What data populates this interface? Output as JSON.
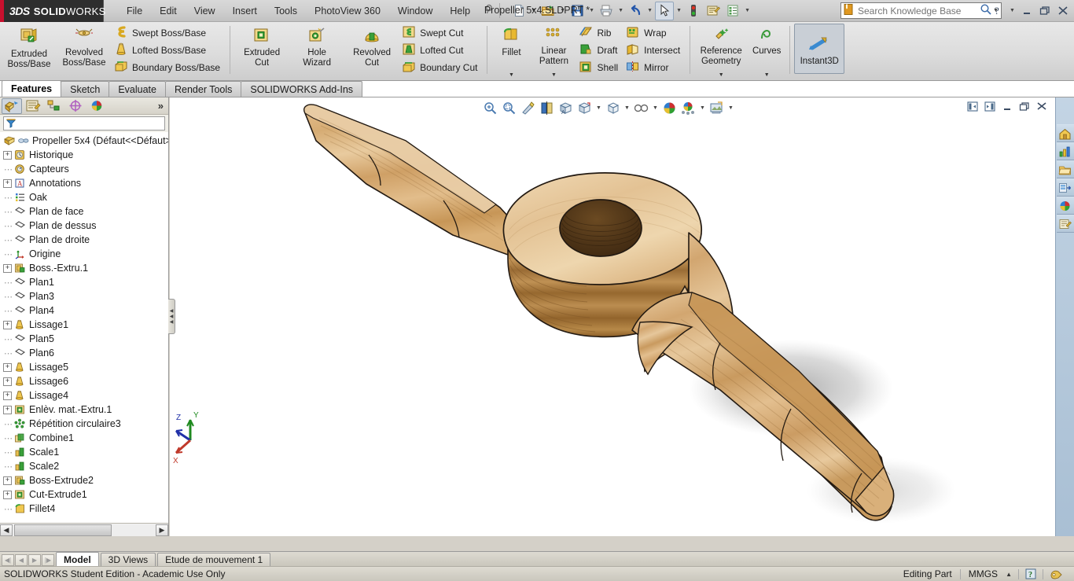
{
  "app": {
    "brand_3ds": "3DS",
    "brand_name_bold": "SOLID",
    "brand_name_light": "WORKS",
    "document_title": "Propeller 5x4.SLDPRT *",
    "accent_red": "#c8102e",
    "logo_bg": "#2e2e2e"
  },
  "menubar": {
    "items": [
      {
        "label": "File",
        "name": "menu-file"
      },
      {
        "label": "Edit",
        "name": "menu-edit"
      },
      {
        "label": "View",
        "name": "menu-view"
      },
      {
        "label": "Insert",
        "name": "menu-insert"
      },
      {
        "label": "Tools",
        "name": "menu-tools"
      },
      {
        "label": "PhotoView 360",
        "name": "menu-photoview-360"
      },
      {
        "label": "Window",
        "name": "menu-window"
      },
      {
        "label": "Help",
        "name": "menu-help"
      }
    ],
    "pin_icon": "pushpin-icon"
  },
  "quick_access": {
    "buttons": [
      {
        "name": "new-document-icon",
        "has_caret": true
      },
      {
        "name": "open-folder-icon",
        "has_caret": true
      },
      {
        "name": "save-icon",
        "has_caret": true
      },
      {
        "name": "print-icon",
        "has_caret": true
      },
      {
        "name": "undo-icon",
        "has_caret": true
      },
      {
        "name": "select-arrow-icon",
        "has_caret": true,
        "pressed": true
      },
      {
        "name": "rebuild-traffic-light-icon",
        "has_caret": false
      },
      {
        "name": "options-icon",
        "has_caret": false
      },
      {
        "name": "customize-menu-icon",
        "has_caret": true
      }
    ]
  },
  "search": {
    "placeholder": "Search Knowledge Base",
    "value": "",
    "icon": "knowledge-base-book-icon",
    "magnifier": "magnifier-icon",
    "caret": "chevron-down-icon"
  },
  "window_controls": {
    "help": "help-question-icon",
    "help_caret": "chevron-down-icon",
    "minimize": "minimize-icon",
    "restore": "restore-icon",
    "close": "close-icon"
  },
  "ribbon": {
    "groups": [
      {
        "name": "boss-base-group",
        "big": [
          {
            "label": "Extruded\nBoss/Base",
            "label_l1": "Extruded",
            "label_l2": "Boss/Base",
            "name": "extruded-boss-base-button",
            "icon": "extruded-boss-icon"
          },
          {
            "label_l1": "Revolved",
            "label_l2": "Boss/Base",
            "name": "revolved-boss-base-button",
            "icon": "revolved-boss-icon"
          }
        ],
        "small": [
          {
            "label": "Swept Boss/Base",
            "name": "swept-boss-base-button",
            "icon": "swept-boss-icon"
          },
          {
            "label": "Lofted Boss/Base",
            "name": "lofted-boss-base-button",
            "icon": "lofted-boss-icon"
          },
          {
            "label": "Boundary Boss/Base",
            "name": "boundary-boss-base-button",
            "icon": "boundary-boss-icon"
          }
        ]
      },
      {
        "name": "cut-group",
        "big": [
          {
            "label_l1": "Extruded",
            "label_l2": "Cut",
            "name": "extruded-cut-button",
            "icon": "extruded-cut-icon"
          },
          {
            "label_l1": "Hole",
            "label_l2": "Wizard",
            "name": "hole-wizard-button",
            "icon": "hole-wizard-icon"
          },
          {
            "label_l1": "Revolved",
            "label_l2": "Cut",
            "name": "revolved-cut-button",
            "icon": "revolved-cut-icon"
          }
        ],
        "small": [
          {
            "label": "Swept Cut",
            "name": "swept-cut-button",
            "icon": "swept-cut-icon"
          },
          {
            "label": "Lofted Cut",
            "name": "lofted-cut-button",
            "icon": "lofted-cut-icon"
          },
          {
            "label": "Boundary Cut",
            "name": "boundary-cut-button",
            "icon": "boundary-cut-icon"
          }
        ]
      },
      {
        "name": "features-group",
        "big": [
          {
            "label_l1": "Fillet",
            "label_l2": "",
            "name": "fillet-button",
            "icon": "fillet-icon",
            "dropdown": true
          },
          {
            "label_l1": "Linear",
            "label_l2": "Pattern",
            "name": "linear-pattern-button",
            "icon": "linear-pattern-icon",
            "dropdown": true
          }
        ],
        "small": [
          {
            "label": "Rib",
            "name": "rib-button",
            "icon": "rib-icon"
          },
          {
            "label": "Draft",
            "name": "draft-button",
            "icon": "draft-icon"
          },
          {
            "label": "Shell",
            "name": "shell-button",
            "icon": "shell-icon"
          }
        ],
        "small2": [
          {
            "label": "Wrap",
            "name": "wrap-button",
            "icon": "wrap-icon"
          },
          {
            "label": "Intersect",
            "name": "intersect-button",
            "icon": "intersect-icon"
          },
          {
            "label": "Mirror",
            "name": "mirror-button",
            "icon": "mirror-icon"
          }
        ]
      },
      {
        "name": "reference-group",
        "big": [
          {
            "label_l1": "Reference",
            "label_l2": "Geometry",
            "name": "reference-geometry-button",
            "icon": "reference-geometry-icon",
            "dropdown": true
          },
          {
            "label_l1": "Curves",
            "label_l2": "",
            "name": "curves-button",
            "icon": "curves-icon",
            "dropdown": true
          }
        ]
      },
      {
        "name": "instant3d-group",
        "big": [
          {
            "label_l1": "Instant3D",
            "label_l2": "",
            "name": "instant3d-button",
            "icon": "instant3d-icon",
            "selected": true
          }
        ]
      }
    ]
  },
  "ribbon_tabs": {
    "items": [
      {
        "label": "Features",
        "name": "tab-features",
        "active": true
      },
      {
        "label": "Sketch",
        "name": "tab-sketch",
        "active": false
      },
      {
        "label": "Evaluate",
        "name": "tab-evaluate",
        "active": false
      },
      {
        "label": "Render Tools",
        "name": "tab-render-tools",
        "active": false
      },
      {
        "label": "SOLIDWORKS Add-Ins",
        "name": "tab-solidworks-add-ins",
        "active": false
      }
    ]
  },
  "tree_panel": {
    "tabs": [
      {
        "name": "feature-manager-tree-tab",
        "icon": "feature-tree-icon",
        "active": true
      },
      {
        "name": "property-manager-tab",
        "icon": "property-manager-icon",
        "active": false
      },
      {
        "name": "configuration-manager-tab",
        "icon": "configuration-manager-icon",
        "active": false
      },
      {
        "name": "dimxpert-manager-tab",
        "icon": "dimxpert-icon",
        "active": false
      },
      {
        "name": "display-manager-tab",
        "icon": "display-manager-icon",
        "active": false
      }
    ],
    "more_icon": "double-chevron-right-icon",
    "filter": {
      "placeholder": "",
      "value": "",
      "icon": "filter-funnel-icon"
    },
    "items": [
      {
        "label": "Propeller 5x4  (Défaut<<Défaut>",
        "icon": "part-icon",
        "indent": 0,
        "expander": "none",
        "root": true
      },
      {
        "label": "Historique",
        "icon": "history-icon",
        "indent": 1,
        "expander": "plus"
      },
      {
        "label": "Capteurs",
        "icon": "sensors-icon",
        "indent": 1,
        "expander": "none"
      },
      {
        "label": "Annotations",
        "icon": "annotations-icon",
        "indent": 1,
        "expander": "plus"
      },
      {
        "label": "Oak",
        "icon": "material-icon",
        "indent": 1,
        "expander": "none"
      },
      {
        "label": "Plan de face",
        "icon": "plane-icon",
        "indent": 1,
        "expander": "none"
      },
      {
        "label": "Plan de dessus",
        "icon": "plane-icon",
        "indent": 1,
        "expander": "none"
      },
      {
        "label": "Plan de droite",
        "icon": "plane-icon",
        "indent": 1,
        "expander": "none"
      },
      {
        "label": "Origine",
        "icon": "origin-icon",
        "indent": 1,
        "expander": "none"
      },
      {
        "label": "Boss.-Extru.1",
        "icon": "boss-extrude-icon",
        "indent": 1,
        "expander": "plus"
      },
      {
        "label": "Plan1",
        "icon": "plane-icon",
        "indent": 1,
        "expander": "none"
      },
      {
        "label": "Plan3",
        "icon": "plane-icon",
        "indent": 1,
        "expander": "none"
      },
      {
        "label": "Plan4",
        "icon": "plane-icon",
        "indent": 1,
        "expander": "none"
      },
      {
        "label": "Lissage1",
        "icon": "loft-icon",
        "indent": 1,
        "expander": "plus"
      },
      {
        "label": "Plan5",
        "icon": "plane-icon",
        "indent": 1,
        "expander": "none"
      },
      {
        "label": "Plan6",
        "icon": "plane-icon",
        "indent": 1,
        "expander": "none"
      },
      {
        "label": "Lissage5",
        "icon": "loft-icon",
        "indent": 1,
        "expander": "plus"
      },
      {
        "label": "Lissage6",
        "icon": "loft-icon",
        "indent": 1,
        "expander": "plus"
      },
      {
        "label": "Lissage4",
        "icon": "loft-icon",
        "indent": 1,
        "expander": "plus"
      },
      {
        "label": "Enlèv. mat.-Extru.1",
        "icon": "cut-extrude-icon",
        "indent": 1,
        "expander": "plus"
      },
      {
        "label": "Répétition circulaire3",
        "icon": "circular-pattern-icon",
        "indent": 1,
        "expander": "none"
      },
      {
        "label": "Combine1",
        "icon": "combine-icon",
        "indent": 1,
        "expander": "none"
      },
      {
        "label": "Scale1",
        "icon": "scale-icon",
        "indent": 1,
        "expander": "none"
      },
      {
        "label": "Scale2",
        "icon": "scale-icon",
        "indent": 1,
        "expander": "none"
      },
      {
        "label": "Boss-Extrude2",
        "icon": "boss-extrude-icon",
        "indent": 1,
        "expander": "plus"
      },
      {
        "label": "Cut-Extrude1",
        "icon": "cut-extrude-icon",
        "indent": 1,
        "expander": "plus"
      },
      {
        "label": "Fillet4",
        "icon": "fillet-tree-icon",
        "indent": 1,
        "expander": "none"
      }
    ],
    "hscroll": {
      "left_arrow": "chevron-left-icon",
      "right_arrow": "chevron-right-icon"
    }
  },
  "view_toolbar": {
    "buttons": [
      {
        "name": "zoom-to-fit-icon",
        "caret": false
      },
      {
        "name": "zoom-to-area-icon",
        "caret": false
      },
      {
        "name": "previous-view-icon",
        "caret": false
      },
      {
        "name": "section-view-icon",
        "caret": false
      },
      {
        "name": "view-orientation-icon",
        "caret": false
      },
      {
        "name": "display-style-icon",
        "caret": true
      },
      {
        "name": "hide-show-items-icon",
        "caret": true
      },
      {
        "name": "edit-appearance-icon",
        "caret": true
      },
      {
        "name": "apply-scene-icon",
        "caret": false
      },
      {
        "name": "view-settings-icon",
        "caret": true
      },
      {
        "name": "save-image-icon",
        "caret": true
      }
    ]
  },
  "doc_controls": {
    "buttons": [
      {
        "name": "collapse-left-pane-icon"
      },
      {
        "name": "expand-right-pane-icon"
      },
      {
        "name": "document-minimize-icon"
      },
      {
        "name": "document-restore-icon"
      },
      {
        "name": "document-close-icon"
      }
    ]
  },
  "task_pane": {
    "buttons": [
      {
        "name": "solidworks-resources-home-icon"
      },
      {
        "name": "design-library-chart-icon"
      },
      {
        "name": "file-explorer-folder-icon"
      },
      {
        "name": "view-palette-icon"
      },
      {
        "name": "appearances-scenes-decals-icon"
      },
      {
        "name": "custom-properties-icon"
      }
    ]
  },
  "triad": {
    "x_label": "X",
    "y_label": "Y",
    "z_label": "Z",
    "x_color": "#c0392b",
    "y_color": "#1f8a1f",
    "z_color": "#2030a8"
  },
  "model": {
    "name": "propeller-5x4-3d-model",
    "material_label": "Oak",
    "wood_light": "#e8c79a",
    "wood_mid": "#cfa066",
    "wood_dark": "#9c6f3a",
    "edge_color": "#231a12"
  },
  "bottom_tabs": {
    "nav": [
      {
        "name": "first-tab-button",
        "glyph": "first-icon"
      },
      {
        "name": "previous-tab-button",
        "glyph": "previous-icon"
      },
      {
        "name": "next-tab-button",
        "glyph": "next-icon"
      },
      {
        "name": "last-tab-button",
        "glyph": "last-icon"
      }
    ],
    "items": [
      {
        "label": "Model",
        "name": "bottom-tab-model",
        "active": true
      },
      {
        "label": "3D Views",
        "name": "bottom-tab-3d-views",
        "active": false
      },
      {
        "label": "Etude de mouvement 1",
        "name": "bottom-tab-motion-study-1",
        "active": false
      }
    ]
  },
  "statusbar": {
    "license_text": "SOLIDWORKS Student Edition - Academic Use Only",
    "editing_state": "Editing Part",
    "units": "MMGS",
    "units_caret": "chevron-up-icon",
    "help_badge": "?",
    "appearance_icon": "appearance-tag-icon"
  }
}
